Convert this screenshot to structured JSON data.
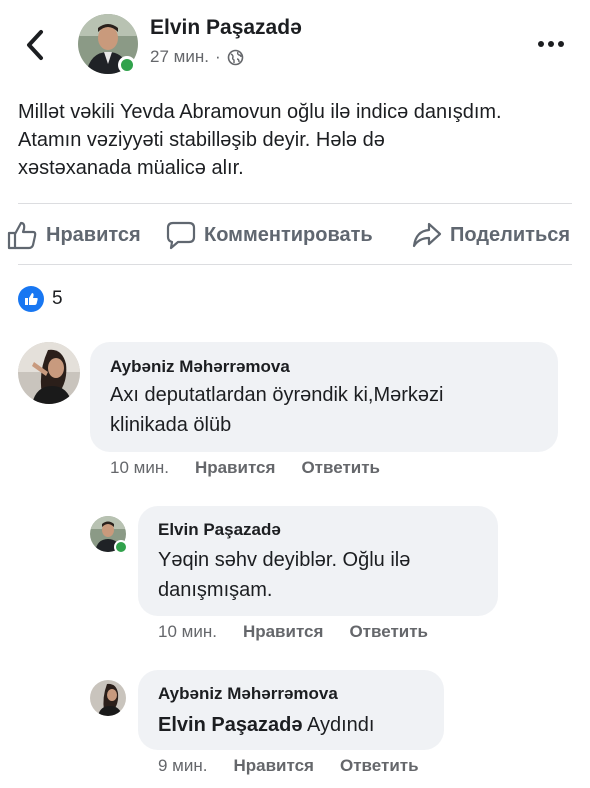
{
  "post": {
    "author": "Elvin Paşazadə",
    "time": "27 мин.",
    "separator": "·",
    "text_lines": [
      "Millət vəkili Yevda Abramovun oğlu ilə indicə danışdım.",
      "Atamın vəziyyəti stabilləşib deyir. Hələ də",
      "xəstəxanada müalicə alır."
    ]
  },
  "actions": {
    "like": "Нравится",
    "comment": "Комментировать",
    "share": "Поделиться"
  },
  "reactions": {
    "count": "5"
  },
  "comments": [
    {
      "author": "Aybəniz Məhərrəmova",
      "lines": [
        "Axı deputatlardan öyrəndik ki,Mərkəzi",
        "klinikada ölüb"
      ],
      "time": "10 мин.",
      "like": "Нравится",
      "reply": "Ответить"
    },
    {
      "author": "Elvin Paşazadə",
      "lines": [
        "Yəqin səhv deyiblər. Oğlu ilə",
        "danışmışam."
      ],
      "time": "10 мин.",
      "like": "Нравится",
      "reply": "Ответить"
    },
    {
      "author": "Aybəniz Məhərrəmova",
      "mention": "Elvin Paşazadə",
      "text": " Aydındı",
      "time": "9 мин.",
      "like": "Нравится",
      "reply": "Ответить"
    }
  ],
  "colors": {
    "like_blue": "#1877f2",
    "online_green": "#31a24c",
    "bubble_bg": "#f0f2f5",
    "secondary_text": "#65676b"
  },
  "icons": [
    "back-chevron-icon",
    "globe-icon",
    "more-icon",
    "thumb-up-icon",
    "comment-icon",
    "share-icon",
    "like-reaction-icon"
  ]
}
